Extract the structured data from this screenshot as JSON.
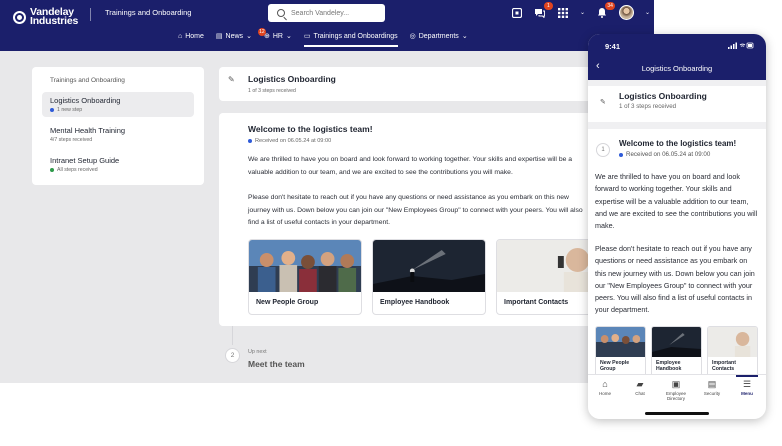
{
  "brand": {
    "name_line1": "Vandelay",
    "name_line2": "Industries",
    "accent": "#1b1f6b",
    "badge_color": "#e0441f"
  },
  "app_title": "Trainings and Onboarding",
  "search": {
    "placeholder": "Search Vandeley..."
  },
  "top_icons": [
    {
      "name": "apps-launcher-icon"
    },
    {
      "name": "chat-icon",
      "badge": "1"
    },
    {
      "name": "grid-icon"
    },
    {
      "name": "bell-icon",
      "badge": "34"
    }
  ],
  "nav": [
    {
      "label": "Home",
      "icon": "home-icon"
    },
    {
      "label": "News",
      "icon": "news-icon"
    },
    {
      "label": "HR",
      "icon": "hr-icon",
      "badge": "12"
    },
    {
      "label": "Trainings and Onboardings",
      "icon": "training-icon",
      "active": true
    },
    {
      "label": "Departments",
      "icon": "globe-icon"
    }
  ],
  "sidebar": {
    "title": "Trainings and Onboarding",
    "items": [
      {
        "name": "Logistics Onboarding",
        "sub": "1 new step",
        "status": "new",
        "dot_color": "#2f5bd8"
      },
      {
        "name": "Mental Health Training",
        "sub": "4/7 steps received"
      },
      {
        "name": "Intranet Setup Guide",
        "sub": "All steps received",
        "status": "done",
        "dot_color": "#2e9a4a"
      }
    ]
  },
  "header": {
    "title": "Logistics Onboarding",
    "sub": "1 of 3 steps received"
  },
  "step1": {
    "number": "1",
    "title": "Welcome to the logistics team!",
    "received": "Received on 06.05.24 at 09:00",
    "para1_desktop": "We are thrilled to have you on board and look forward to working together. Your skills and expertise will be a valuable addition to our team, and we are excited to see the contributions you will make.",
    "para2_desktop": "Please don't hesitate to reach out if you have any questions or need assistance as you embark on this new journey with us. Down below you can join our \"New Employees Group\" to connect with your peers. You will also find a list of useful contacts in your department.",
    "tiles": [
      "New People Group",
      "Employee Handbook",
      "Important Contacts"
    ]
  },
  "up_next": {
    "label": "Up next",
    "number": "2",
    "title": "Meet the team"
  },
  "phone": {
    "time": "9:41",
    "title": "Logistics Onboarding",
    "header_title": "Logistics Onboarding",
    "header_sub": "1 of 3 steps received",
    "step_number": "1",
    "step_title": "Welcome to the logistics team!",
    "received": "Received on 06.05.24 at 09:00",
    "para1": "We are thrilled to have you on board and look forward to working together. Your skills and expertise will be a valuable addition to our team, and we are excited to see the contributions you will make.",
    "para2": "Please don't hesitate to reach out if you have any questions or need assistance as you embark on this new journey with us. Down below you can join our \"New Employees Group\" to connect with your peers. You will also find a list of useful contacts in your department.",
    "tiles": [
      "New People Group",
      "Employee Handbook",
      "Important Contacts"
    ],
    "tabs": [
      {
        "label": "Home",
        "icon": "home-icon"
      },
      {
        "label": "Chat",
        "icon": "chat-icon"
      },
      {
        "label": "Employee Directory",
        "icon": "directory-icon"
      },
      {
        "label": "Security",
        "icon": "document-icon"
      },
      {
        "label": "Menu",
        "icon": "menu-icon",
        "active": true
      }
    ]
  }
}
